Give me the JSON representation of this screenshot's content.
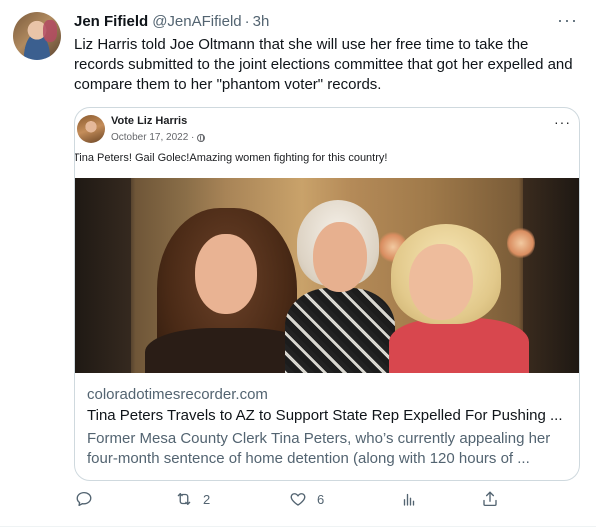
{
  "tweet": {
    "author_name": "Jen Fifield",
    "handle": "@JenAFifield",
    "separator": "·",
    "time": "3h",
    "more": "···",
    "text": "Liz Harris told Joe Oltmann that she will use her free time to take the records submitted to the joint elections committee that got her expelled and compare them to her \"phantom voter\" records."
  },
  "card": {
    "fb_post": {
      "page_name": "Vote Liz Harris",
      "date": "October 17, 2022 ·",
      "more": "···",
      "caption": "Tina Peters! Gail Golec!Amazing women fighting for this country!"
    },
    "domain": "coloradotimesrecorder.com",
    "title": "Tina Peters Travels to AZ to Support State Rep Expelled For Pushing ...",
    "description": "Former Mesa County Clerk Tina Peters, who’s currently appealing her four-month sentence of home detention (along with 120 hours of ..."
  },
  "actions": {
    "reply_icon": "reply-icon",
    "retweet_icon": "retweet-icon",
    "retweet_count": "2",
    "like_icon": "heart-icon",
    "like_count": "6",
    "views_icon": "views-icon",
    "share_icon": "share-icon"
  },
  "colors": {
    "text": "#0f1419",
    "secondary": "#536471",
    "border": "#cfd9de"
  }
}
